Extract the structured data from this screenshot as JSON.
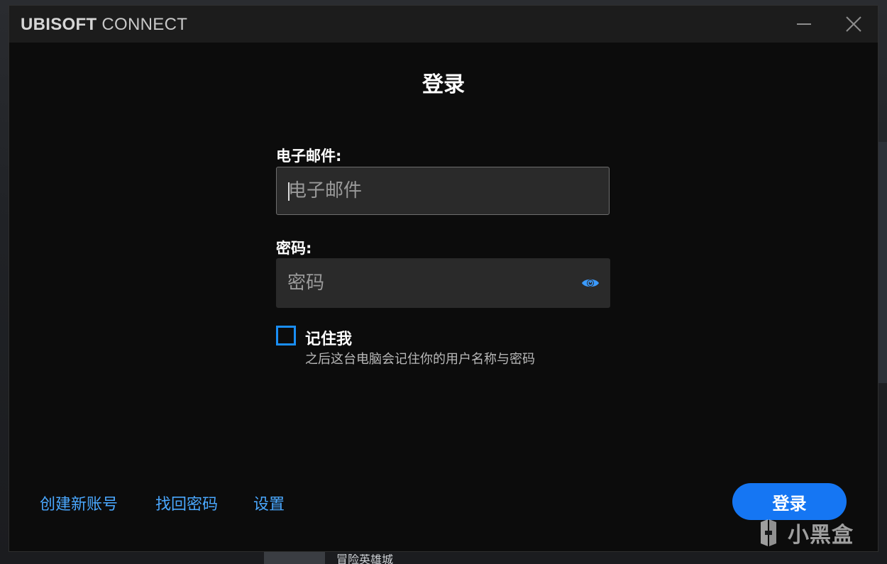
{
  "window": {
    "brand_bold": "UBISOFT",
    "brand_light": " CONNECT"
  },
  "login": {
    "heading": "登录",
    "email_label": "电子邮件:",
    "email_placeholder": "电子邮件",
    "email_value": "",
    "password_label": "密码:",
    "password_placeholder": "密码",
    "password_value": "",
    "remember_label": "记住我",
    "remember_hint": "之后这台电脑会记住你的用户名称与密码",
    "remember_checked": false,
    "submit_label": "登录"
  },
  "footer": {
    "create_account": "创建新账号",
    "recover_password": "找回密码",
    "settings": "设置"
  },
  "watermark": {
    "text": "小黑盒"
  },
  "background": {
    "peek_text": "冒险英雄城"
  },
  "colors": {
    "accent": "#1576f3",
    "link": "#4aa8ff",
    "checkbox": "#1a8ef5",
    "window_bg": "#0c0c0c",
    "titlebar_bg": "#1c1c1c",
    "field_bg": "#2a2a2a"
  },
  "icons": {
    "show_password": "eye-icon",
    "minimize": "minimize-icon",
    "close": "close-icon",
    "watermark_logo": "xiaoheihe-logo-icon"
  }
}
